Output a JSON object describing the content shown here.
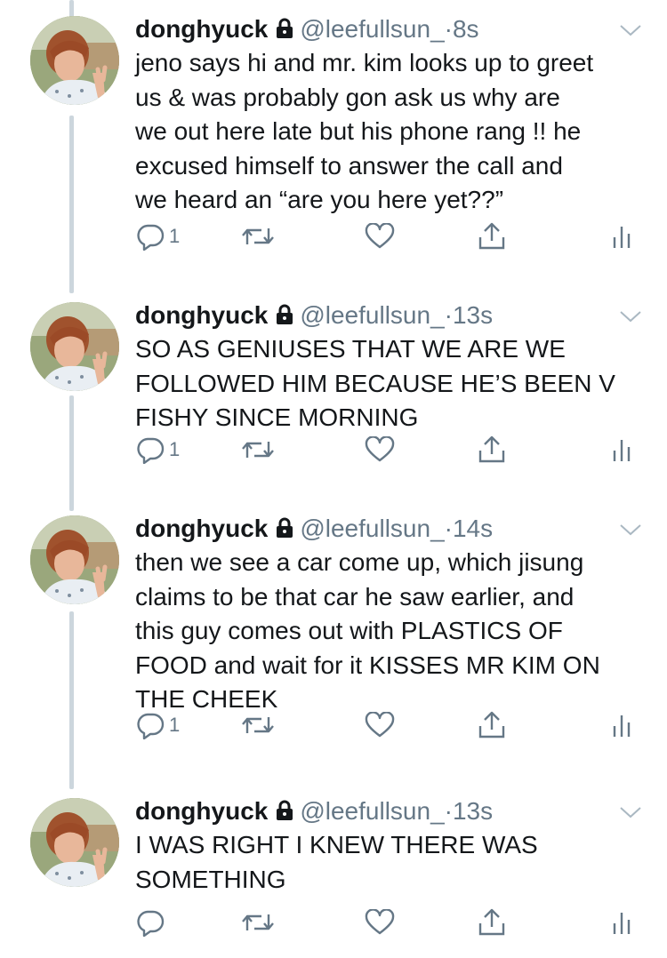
{
  "tweets": [
    {
      "name": "donghyuck",
      "handle": "@leefullsun_",
      "dot": "·",
      "time": "8s",
      "text": "jeno says hi and mr. kim looks up to greet\nus & was probably gon ask us why are\nwe out here late but his phone rang !! he\nexcused himself to answer the call and\nwe heard an “are you here yet??”",
      "reply_count": "1"
    },
    {
      "name": "donghyuck",
      "handle": "@leefullsun_",
      "dot": "·",
      "time": "13s",
      "text": "SO AS GENIUSES THAT WE ARE WE\nFOLLOWED HIM BECAUSE HE’S BEEN V\nFISHY SINCE MORNING",
      "reply_count": "1"
    },
    {
      "name": "donghyuck",
      "handle": "@leefullsun_",
      "dot": "·",
      "time": "14s",
      "text": "then we see a car come up, which jisung\nclaims to be that car he saw earlier, and\nthis guy comes out with PLASTICS OF\nFOOD and wait for it KISSES MR KIM ON\nTHE CHEEK",
      "reply_count": "1"
    },
    {
      "name": "donghyuck",
      "handle": "@leefullsun_",
      "dot": "·",
      "time": "13s",
      "text": "I WAS RIGHT I KNEW THERE WAS\nSOMETHING",
      "reply_count": ""
    }
  ],
  "icons": {
    "lock": "lock-icon",
    "more": "chevron-down-icon",
    "reply": "reply-icon",
    "retweet": "retweet-icon",
    "like": "heart-icon",
    "share": "share-icon",
    "analytics": "analytics-icon"
  },
  "colors": {
    "text": "#14171a",
    "secondary": "#657786",
    "thread_line": "#ccd6dd"
  }
}
